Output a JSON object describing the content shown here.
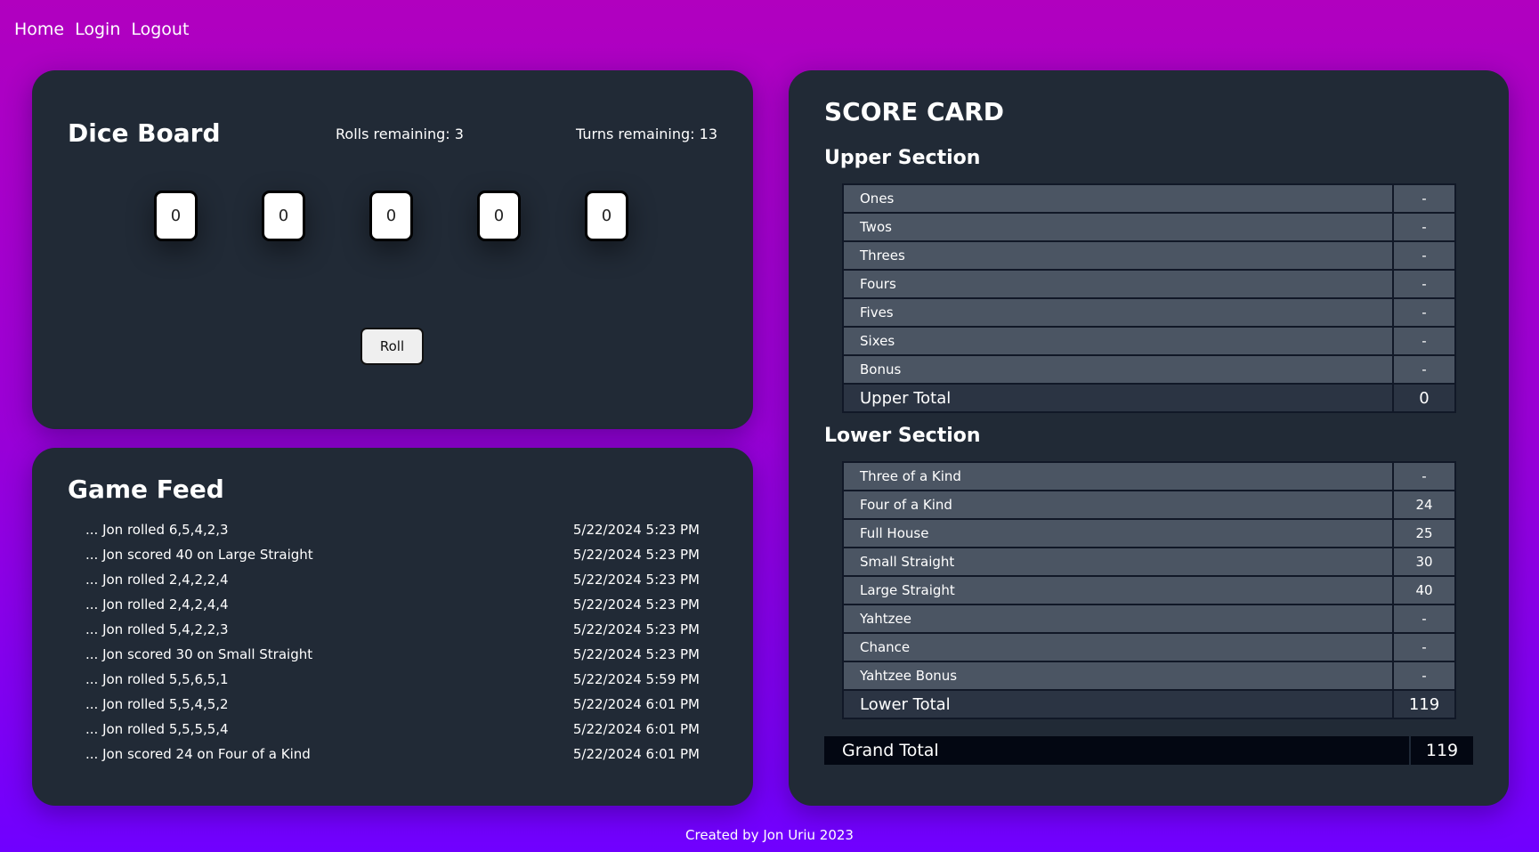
{
  "nav": {
    "home": "Home",
    "login": "Login",
    "logout": "Logout"
  },
  "dice_board": {
    "title": "Dice Board",
    "rolls_remaining": "Rolls remaining: 3",
    "turns_remaining": "Turns remaining: 13",
    "dice": [
      "0",
      "0",
      "0",
      "0",
      "0"
    ],
    "roll_label": "Roll"
  },
  "game_feed": {
    "title": "Game Feed",
    "entries": [
      {
        "text": "... Jon rolled 6,5,4,2,3",
        "time": "5/22/2024 5:23 PM"
      },
      {
        "text": "... Jon scored 40 on Large Straight",
        "time": "5/22/2024 5:23 PM"
      },
      {
        "text": "... Jon rolled 2,4,2,2,4",
        "time": "5/22/2024 5:23 PM"
      },
      {
        "text": "... Jon rolled 2,4,2,4,4",
        "time": "5/22/2024 5:23 PM"
      },
      {
        "text": "... Jon rolled 5,4,2,2,3",
        "time": "5/22/2024 5:23 PM"
      },
      {
        "text": "... Jon scored 30 on Small Straight",
        "time": "5/22/2024 5:23 PM"
      },
      {
        "text": "... Jon rolled 5,5,6,5,1",
        "time": "5/22/2024 5:59 PM"
      },
      {
        "text": "... Jon rolled 5,5,4,5,2",
        "time": "5/22/2024 6:01 PM"
      },
      {
        "text": "... Jon rolled 5,5,5,5,4",
        "time": "5/22/2024 6:01 PM"
      },
      {
        "text": "... Jon scored 24 on Four of a Kind",
        "time": "5/22/2024 6:01 PM"
      }
    ]
  },
  "score_card": {
    "title": "SCORE CARD",
    "upper": {
      "title": "Upper Section",
      "rows": [
        {
          "label": "Ones",
          "value": "-"
        },
        {
          "label": "Twos",
          "value": "-"
        },
        {
          "label": "Threes",
          "value": "-"
        },
        {
          "label": "Fours",
          "value": "-"
        },
        {
          "label": "Fives",
          "value": "-"
        },
        {
          "label": "Sixes",
          "value": "-"
        },
        {
          "label": "Bonus",
          "value": "-"
        }
      ],
      "total_label": "Upper Total",
      "total_value": "0"
    },
    "lower": {
      "title": "Lower Section",
      "rows": [
        {
          "label": "Three of a Kind",
          "value": "-"
        },
        {
          "label": "Four of a Kind",
          "value": "24"
        },
        {
          "label": "Full House",
          "value": "25"
        },
        {
          "label": "Small Straight",
          "value": "30"
        },
        {
          "label": "Large Straight",
          "value": "40"
        },
        {
          "label": "Yahtzee",
          "value": "-"
        },
        {
          "label": "Chance",
          "value": "-"
        },
        {
          "label": "Yahtzee Bonus",
          "value": "-"
        }
      ],
      "total_label": "Lower Total",
      "total_value": "119"
    },
    "grand_total_label": "Grand Total",
    "grand_total_value": "119"
  },
  "footer": "Created by Jon Uriu 2023"
}
